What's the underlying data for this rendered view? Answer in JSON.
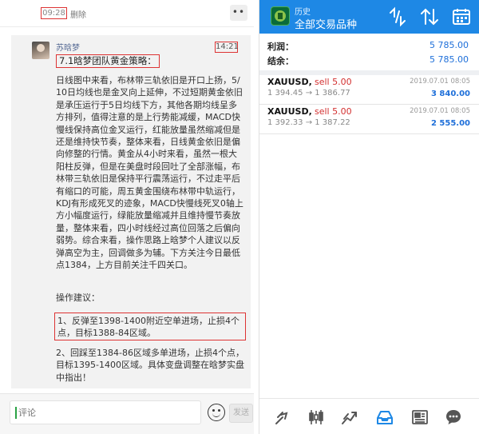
{
  "chat": {
    "post_time": "09:28",
    "delete_label": "删除",
    "more_label": "••",
    "author": "苏晗梦",
    "message_time": "14:21",
    "headline": "7.1晗梦团队黄金策略：",
    "body": "日线图中来看，布林带三轨依旧是开口上扬，5/10日均线也是金叉向上延伸，不过短期黄金依旧是承压运行于5日均线下方，其他各期均线呈多方排列，值得注意的是上行势能减缓，MACD快慢线保持高位金叉运行，红能放量虽然缩减但是还是维持快节奏，整体来看，日线黄金依旧是偏向修整的行情。黄金从4小时来看，虽然一根大阳柱反弹，但是在美盘时段回吐了全部涨幅，布林带三轨依旧是保持平行震荡运行，不过走平后有缩口的可能，周五黄金围绕布林带中轨运行，KDJ有形成死叉的迹象，MACD快慢线死叉0轴上方小幅度运行，绿能放量缩减并且维持慢节奏放量，整体来看，四小时线经过高位回落之后偏向弱势。综合来看，操作思路上晗梦个人建议以反弹高空为主，回调做多为辅。下方关注今日最低点1384，上方目前关注千四关口。",
    "ops_title": "操作建议：",
    "op1": "1、反弹至1398-1400附近空单进场，止损4个点，目标1388-84区域。",
    "op2": "2、回踩至1384-86区域多单进场，止损4个点，目标1395-1400区域。具体变盘调整在晗梦实盘中指出！",
    "input_placeholder": "评论",
    "send_label": "发送"
  },
  "app": {
    "header_title": "历史",
    "header_subtitle": "全部交易品种",
    "summary": [
      {
        "label": "利润：",
        "value": "5 785.00"
      },
      {
        "label": "结余：",
        "value": "5 785.00"
      }
    ],
    "trades": [
      {
        "symbol": "XAUUSD,",
        "side": "sell 5.00",
        "date": "2019.07.01 08:05",
        "prices": "1 394.45 → 1 386.77",
        "profit": "3 840.00"
      },
      {
        "symbol": "XAUUSD,",
        "side": "sell 5.00",
        "date": "2019.07.01 08:05",
        "prices": "1 392.33 → 1 387.22",
        "profit": "2 555.00"
      }
    ],
    "colors": {
      "header": "#1e88e5",
      "profit": "#1e6fd9",
      "sell": "#d32f2f",
      "nav_active": "#1e88e5"
    },
    "header_icons": [
      "swap-currency-icon",
      "sort-icon",
      "calendar-icon"
    ],
    "nav_icons": [
      "quotes-icon",
      "chart-icon",
      "trade-icon",
      "history-icon",
      "news-icon",
      "chat-icon"
    ]
  }
}
